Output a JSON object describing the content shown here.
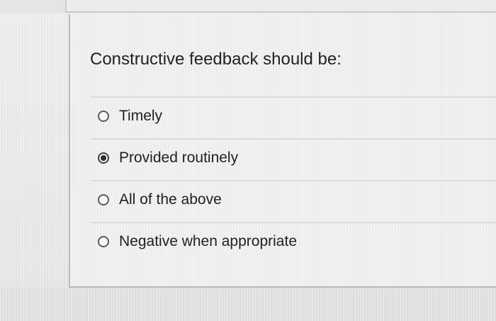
{
  "question": {
    "text": "Constructive feedback should be:"
  },
  "options": [
    {
      "label": "Timely",
      "selected": false
    },
    {
      "label": "Provided routinely",
      "selected": true
    },
    {
      "label": "All of the above",
      "selected": false
    },
    {
      "label": "Negative when appropriate",
      "selected": false
    }
  ],
  "colors": {
    "background": "#e9eaea",
    "card": "#eff1f1",
    "text": "#1f1f1f",
    "radio_border": "#5a5c5c",
    "radio_dot": "#2e2f2f"
  },
  "icons": {
    "radio_unselected": "radio-unchecked-icon",
    "radio_selected": "radio-checked-icon"
  }
}
